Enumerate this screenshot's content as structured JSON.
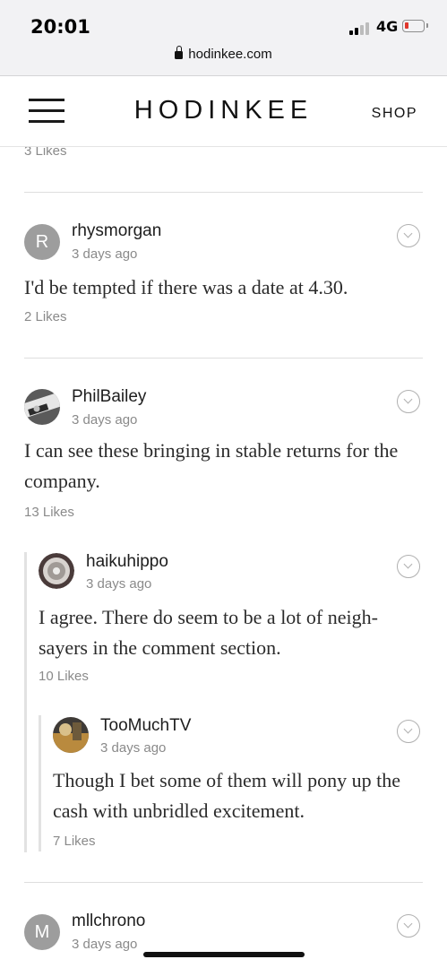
{
  "status": {
    "time": "20:01",
    "network": "4G"
  },
  "browser": {
    "url": "hodinkee.com"
  },
  "nav": {
    "logo": "HODINKEE",
    "shop": "SHOP"
  },
  "prev_comment": {
    "likes": "3 Likes"
  },
  "comments": [
    {
      "initial": "R",
      "user": "rhysmorgan",
      "ago": "3 days ago",
      "body": "I'd be tempted if there was a date at 4.30.",
      "likes": "2 Likes"
    },
    {
      "user": "PhilBailey",
      "ago": "3 days ago",
      "body": "I can see these bringing in stable returns for the company.",
      "likes": "13 Likes"
    },
    {
      "user": "haikuhippo",
      "ago": "3 days ago",
      "body": "I agree. There do seem to be a lot of neigh-sayers in the comment section.",
      "likes": "10 Likes"
    },
    {
      "user": "TooMuchTV",
      "ago": "3 days ago",
      "body": "Though I bet some of them will pony up the cash with unbridled excitement.",
      "likes": "7 Likes"
    },
    {
      "initial": "M",
      "user": "mllchrono",
      "ago": "3 days ago"
    }
  ]
}
